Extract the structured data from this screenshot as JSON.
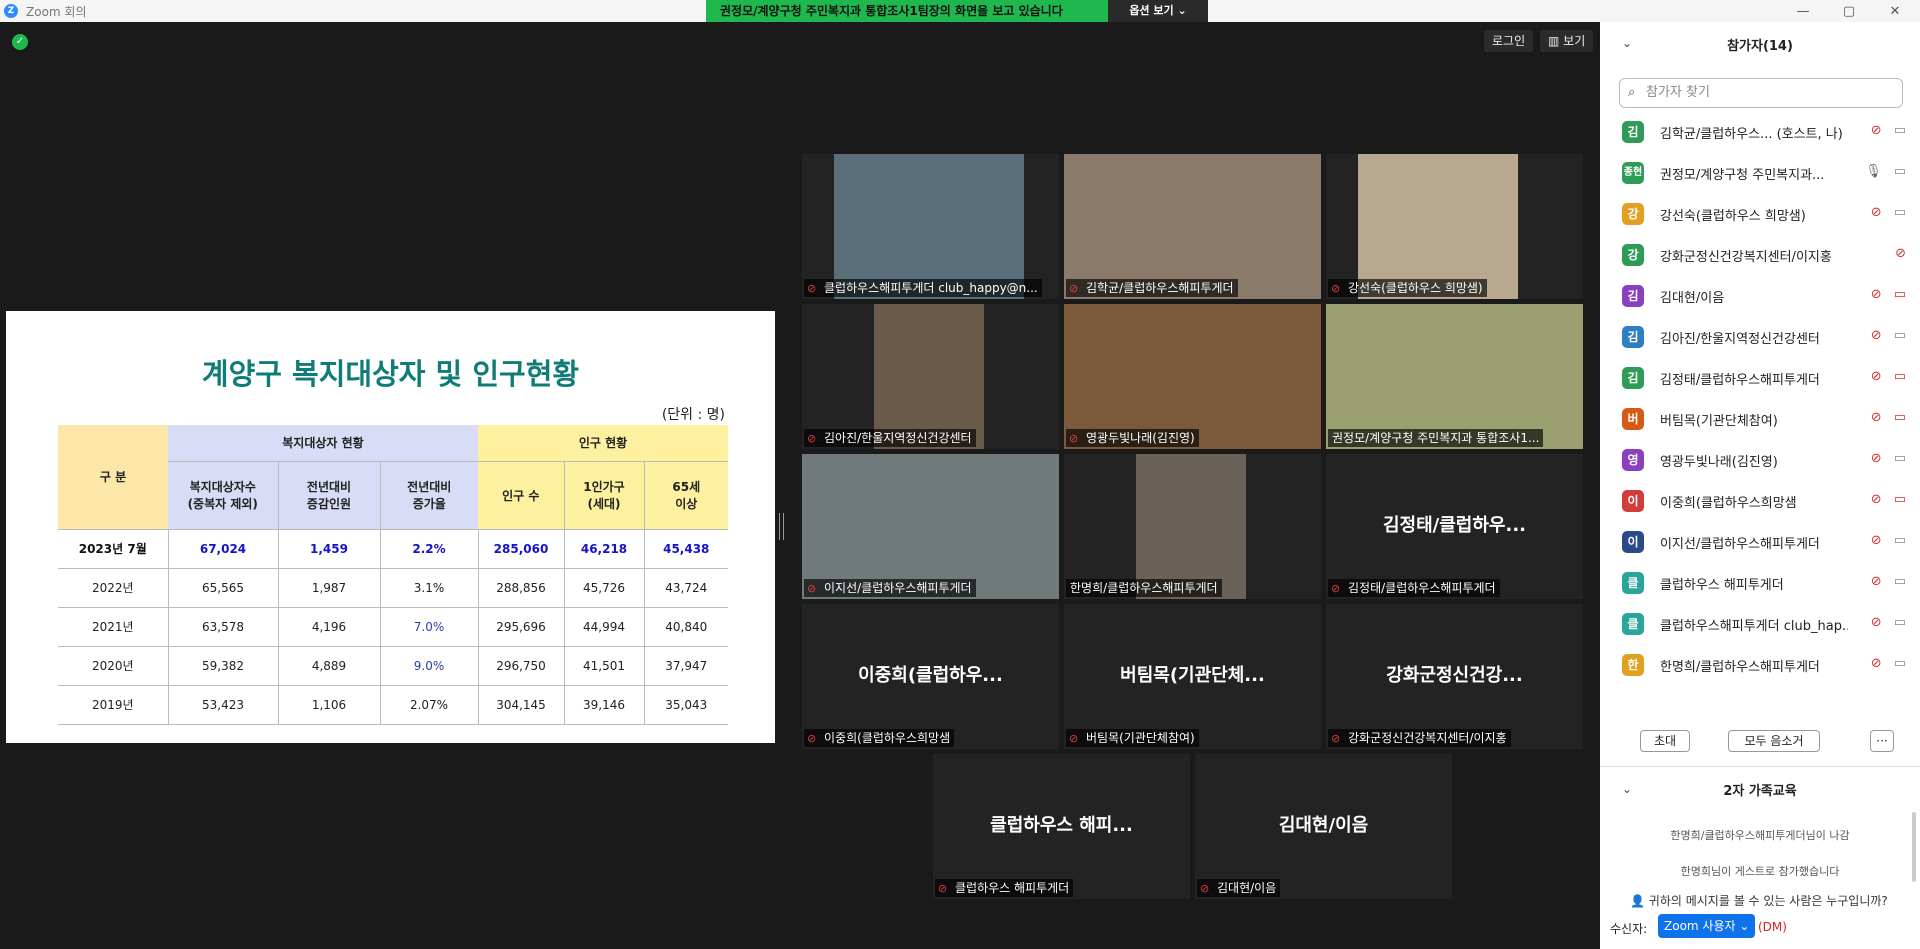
{
  "window": {
    "title": "Zoom 회의",
    "minimize": "—",
    "maximize": "▢",
    "close": "✕"
  },
  "share_banner": {
    "message": "권정모/계양구청 주민복지과 통합조사1팀장의 화면을 보고 있습니다",
    "options_label": "옵션 보기 ⌄"
  },
  "top_buttons": {
    "login": "로그인",
    "view": "▥ 보기"
  },
  "slide": {
    "title": "계양구 복지대상자 및 인구현황",
    "unit": "(단위 : 명)",
    "header_category": "구 분",
    "group1": "복지대상자 현황",
    "group2": "인구 현황",
    "cols": [
      "복지대상자수\n(중복자 제외)",
      "전년대비\n증감인원",
      "전년대비\n증가율",
      "인구 수",
      "1인가구\n(세대)",
      "65세\n이상"
    ],
    "rows": [
      [
        "2023년 7월",
        "67,024",
        "1,459",
        "2.2%",
        "285,060",
        "46,218",
        "45,438"
      ],
      [
        "2022년",
        "65,565",
        "1,987",
        "3.1%",
        "288,856",
        "45,726",
        "43,724"
      ],
      [
        "2021년",
        "63,578",
        "4,196",
        "7.0%",
        "295,696",
        "44,994",
        "40,840"
      ],
      [
        "2020년",
        "59,382",
        "4,889",
        "9.0%",
        "296,750",
        "41,501",
        "37,947"
      ],
      [
        "2019년",
        "53,423",
        "1,106",
        "2.07%",
        "304,145",
        "39,146",
        "35,043"
      ]
    ]
  },
  "tiles": [
    {
      "label": "클럽하우스해피투게더 club_happy@n...",
      "big": "",
      "muted": true,
      "video": "#5a6f7a"
    },
    {
      "label": "김학균/클럽하우스해피투게더",
      "big": "",
      "muted": true,
      "video": "#8a7a6a"
    },
    {
      "label": "강선숙(클럽하우스 희망샘)",
      "big": "",
      "muted": true,
      "video": "#b8a890"
    },
    {
      "label": "김아진/한울지역정신건강센터",
      "big": "",
      "muted": true,
      "video": "#6a5a4a"
    },
    {
      "label": "영광두빛나래(김진영)",
      "big": "",
      "muted": true,
      "video": "#7a5a3a"
    },
    {
      "label": "권정모/계양구청 주민복지과 통합조사1...",
      "big": "",
      "muted": false,
      "video": "#9aa070"
    },
    {
      "label": "이지선/클럽하우스해피투게더",
      "big": "",
      "muted": true,
      "video": "#707a7a"
    },
    {
      "label": "한명희/클럽하우스해피투게더",
      "big": "",
      "muted": false,
      "video": "#6a6258"
    },
    {
      "label": "김정태/클럽하우스해피투게더",
      "big": "김정태/클럽하우...",
      "muted": true,
      "video": ""
    },
    {
      "label": "이중희(클럽하우스희망샘",
      "big": "이중희(클럽하우...",
      "muted": true,
      "video": ""
    },
    {
      "label": "버팀목(기관단체참여)",
      "big": "버팀목(기관단체...",
      "muted": true,
      "video": ""
    },
    {
      "label": "강화군정신건강복지센터/이지홍",
      "big": "강화군정신건강...",
      "muted": true,
      "video": ""
    },
    {
      "label": "클럽하우스 해피투게더",
      "big": "클럽하우스 해피...",
      "muted": true,
      "video": ""
    },
    {
      "label": "김대현/이음",
      "big": "김대현/이음",
      "muted": true,
      "video": ""
    }
  ],
  "panel": {
    "title": "참가자(14)",
    "search_placeholder": "참가자 찾기",
    "participants": [
      {
        "initial": "김",
        "name": "김학균/클럽하우스...   (호스트, 나)",
        "color": "#2e9b57",
        "cam_off": false
      },
      {
        "initial": "종현",
        "name": "권정모/계양구청 주민복지과...",
        "color": "#2e9b57",
        "cam_off": false
      },
      {
        "initial": "강",
        "name": "강선숙(클럽하우스 희망샘)",
        "color": "#e0a020",
        "cam_off": false
      },
      {
        "initial": "강",
        "name": "강화군정신건강복지센터/이지홍",
        "color": "#2e9b57",
        "cam_off": false
      },
      {
        "initial": "김",
        "name": "김대현/이음",
        "color": "#8a3fc0",
        "cam_off": true
      },
      {
        "initial": "김",
        "name": "김아진/한울지역정신건강센터",
        "color": "#2d7fc1",
        "cam_off": false
      },
      {
        "initial": "김",
        "name": "김정태/클럽하우스해피투게더",
        "color": "#2e9b57",
        "cam_off": true
      },
      {
        "initial": "버",
        "name": "버팀목(기관단체참여)",
        "color": "#d75a14",
        "cam_off": true
      },
      {
        "initial": "영",
        "name": "영광두빛나래(김진영)",
        "color": "#8a3fc0",
        "cam_off": false
      },
      {
        "initial": "이",
        "name": "이중희(클럽하우스희망샘",
        "color": "#d43c3c",
        "cam_off": true
      },
      {
        "initial": "이",
        "name": "이지선/클럽하우스해피투게더",
        "color": "#2a4a8a",
        "cam_off": false
      },
      {
        "initial": "클",
        "name": "클럽하우스 해피투게더",
        "color": "#2aa59a",
        "cam_off": false
      },
      {
        "initial": "클",
        "name": "클럽하우스해피투게더 club_hap...",
        "color": "#2aa59a",
        "cam_off": false
      },
      {
        "initial": "한",
        "name": "한명희/클럽하우스해피투게더",
        "color": "#e0a020",
        "cam_off": false
      }
    ],
    "invite": "초대",
    "mute_all": "모두 음소거",
    "more": "···",
    "chat_title": "2자 가족교육",
    "chat_messages": [
      "한명희/클럽하우스해피투게더님이 나감",
      "한명희님이 게스트로 참가했습니다"
    ],
    "who_can_see": "귀하의 메시지를 볼 수 있는 사람은 누구입니까?",
    "recipient_label": "수신자:",
    "recipient_value": "Zoom 사용자 ⌄",
    "dm": "(DM)"
  }
}
